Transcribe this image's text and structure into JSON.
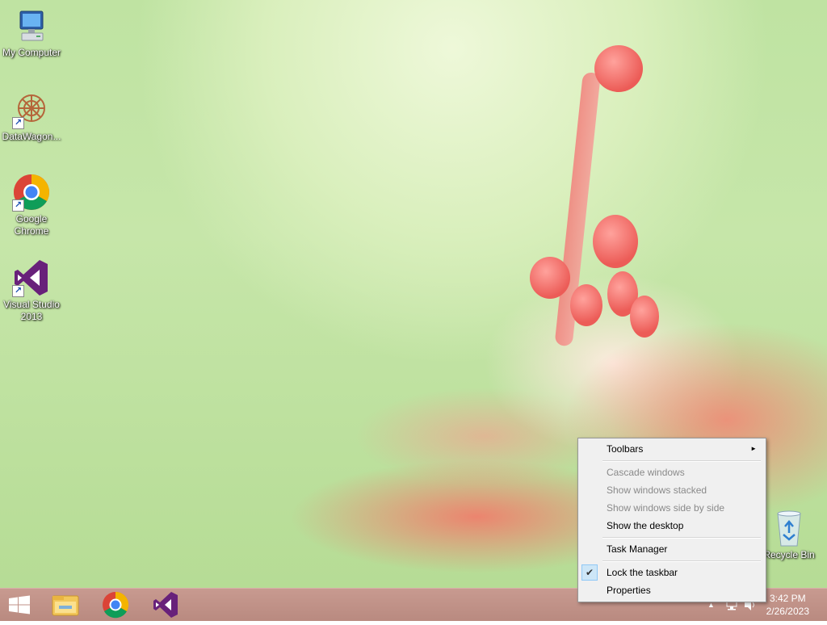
{
  "desktop": {
    "icons": [
      {
        "label": "My Computer",
        "icon": "computer-icon"
      },
      {
        "label": "DataWagon...",
        "icon": "datawagon-icon"
      },
      {
        "label": "Google Chrome",
        "icon": "chrome-icon"
      },
      {
        "label": "Visual Studio 2013",
        "icon": "visual-studio-icon"
      },
      {
        "label": "Recycle Bin",
        "icon": "recycle-bin-icon"
      }
    ]
  },
  "context_menu": {
    "items": [
      {
        "label": "Toolbars",
        "enabled": true,
        "has_submenu": true
      },
      {
        "label": "Cascade windows",
        "enabled": false
      },
      {
        "label": "Show windows stacked",
        "enabled": false
      },
      {
        "label": "Show windows side by side",
        "enabled": false
      },
      {
        "label": "Show the desktop",
        "enabled": true
      },
      {
        "label": "Task Manager",
        "enabled": true
      },
      {
        "label": "Lock the taskbar",
        "enabled": true,
        "checked": true
      },
      {
        "label": "Properties",
        "enabled": true
      }
    ],
    "submenu_arrow": "►",
    "check_mark": "✔"
  },
  "taskbar": {
    "pinned": [
      "file-explorer-icon",
      "chrome-icon",
      "visual-studio-icon"
    ],
    "clock": {
      "time": "3:42 PM",
      "date": "2/26/2023"
    },
    "tray": {
      "chevron": "▲"
    }
  },
  "colors": {
    "taskbar": "#c89a90",
    "menu_bg": "#f0f0f0",
    "disabled_text": "#8a8a8a",
    "vs_purple": "#68217a"
  }
}
